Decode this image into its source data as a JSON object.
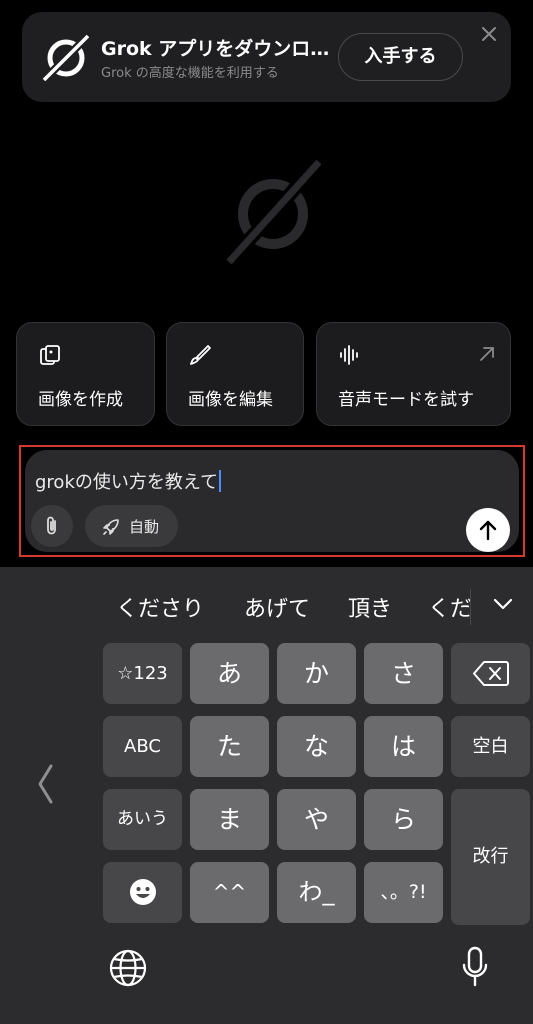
{
  "banner": {
    "title": "Grok アプリをダウンロ…",
    "subtitle": "Grok の高度な機能を利用する",
    "get_button": "入手する",
    "logo_icon": "grok-logo-icon",
    "close_icon": "close-icon"
  },
  "center_logo": "grok-logo-icon",
  "actions": [
    {
      "label": "画像を作成",
      "icon": "image-create-icon"
    },
    {
      "label": "画像を編集",
      "icon": "brush-icon"
    },
    {
      "label": "音声モードを試す",
      "icon": "waveform-icon"
    }
  ],
  "composer": {
    "text": "grokの使い方を教えて",
    "mode_label": "自動",
    "attach_icon": "paperclip-icon",
    "mode_icon": "rocket-icon",
    "send_icon": "arrow-up-icon"
  },
  "keyboard": {
    "suggestions": [
      "くださり",
      "あげて",
      "頂き",
      "くだ"
    ],
    "keys": {
      "sym": "☆123",
      "abc": "ABC",
      "aiu": "あいう",
      "a": "あ",
      "ka": "か",
      "sa": "さ",
      "ta": "た",
      "na": "な",
      "ha": "は",
      "ma": "ま",
      "ya": "や",
      "ra": "ら",
      "caret": "^^",
      "wa": "わ_",
      "punct": "、。?!",
      "space": "空白",
      "enter": "改行"
    }
  },
  "colors": {
    "highlight_border": "#d33a2c",
    "caret": "#4a8dff"
  }
}
